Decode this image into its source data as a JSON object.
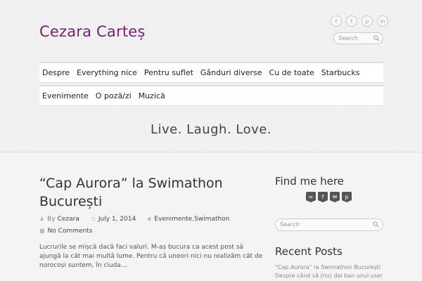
{
  "site": {
    "title": "Cezara Carteș",
    "tagline": "Live. Laugh. Love."
  },
  "header": {
    "social": [
      {
        "icon": "facebook-icon",
        "glyph": "f"
      },
      {
        "icon": "twitter-icon",
        "glyph": "t"
      },
      {
        "icon": "pinterest-icon",
        "glyph": "p"
      },
      {
        "icon": "linkedin-icon",
        "glyph": "in"
      }
    ],
    "search_placeholder": "Search"
  },
  "nav": {
    "row1": [
      "Despre",
      "Everything nice",
      "Pentru suflet",
      "Gânduri diverse",
      "Cu de toate",
      "Starbucks"
    ],
    "row2": [
      "Evenimente",
      "O poză/zi",
      "Muzică"
    ]
  },
  "post": {
    "title": "“Cap Aurora” la Swimathon București",
    "by": "By",
    "author": "Cezara",
    "date": "July 1, 2014",
    "categories": "Evenimente, Swimathon",
    "cat_1": "Evenimente",
    "cat_sep": ", ",
    "cat_2": "Swimathon",
    "comments": "No Comments",
    "excerpt": "Lucrurile se mișcă dacă faci valuri. M-aș bucura ca acest post să ajungă la cât mai multă lume. Pentru că uneori nici nu realizăm cât de norocoși suntem, în ciuda…"
  },
  "sidebar": {
    "find_me_title": "Find me here",
    "badges": [
      {
        "icon": "rss-icon",
        "glyph": "≈"
      },
      {
        "icon": "facebook-icon",
        "glyph": "f"
      },
      {
        "icon": "email-icon",
        "glyph": "✉"
      },
      {
        "icon": "pinterest-icon",
        "glyph": "p"
      }
    ],
    "search_placeholder": "Search",
    "recent_title": "Recent Posts",
    "recent_1": "“Cap Aurora” la Swimathon București",
    "recent_2": "Despre când să (nu) dai ban unui user"
  }
}
